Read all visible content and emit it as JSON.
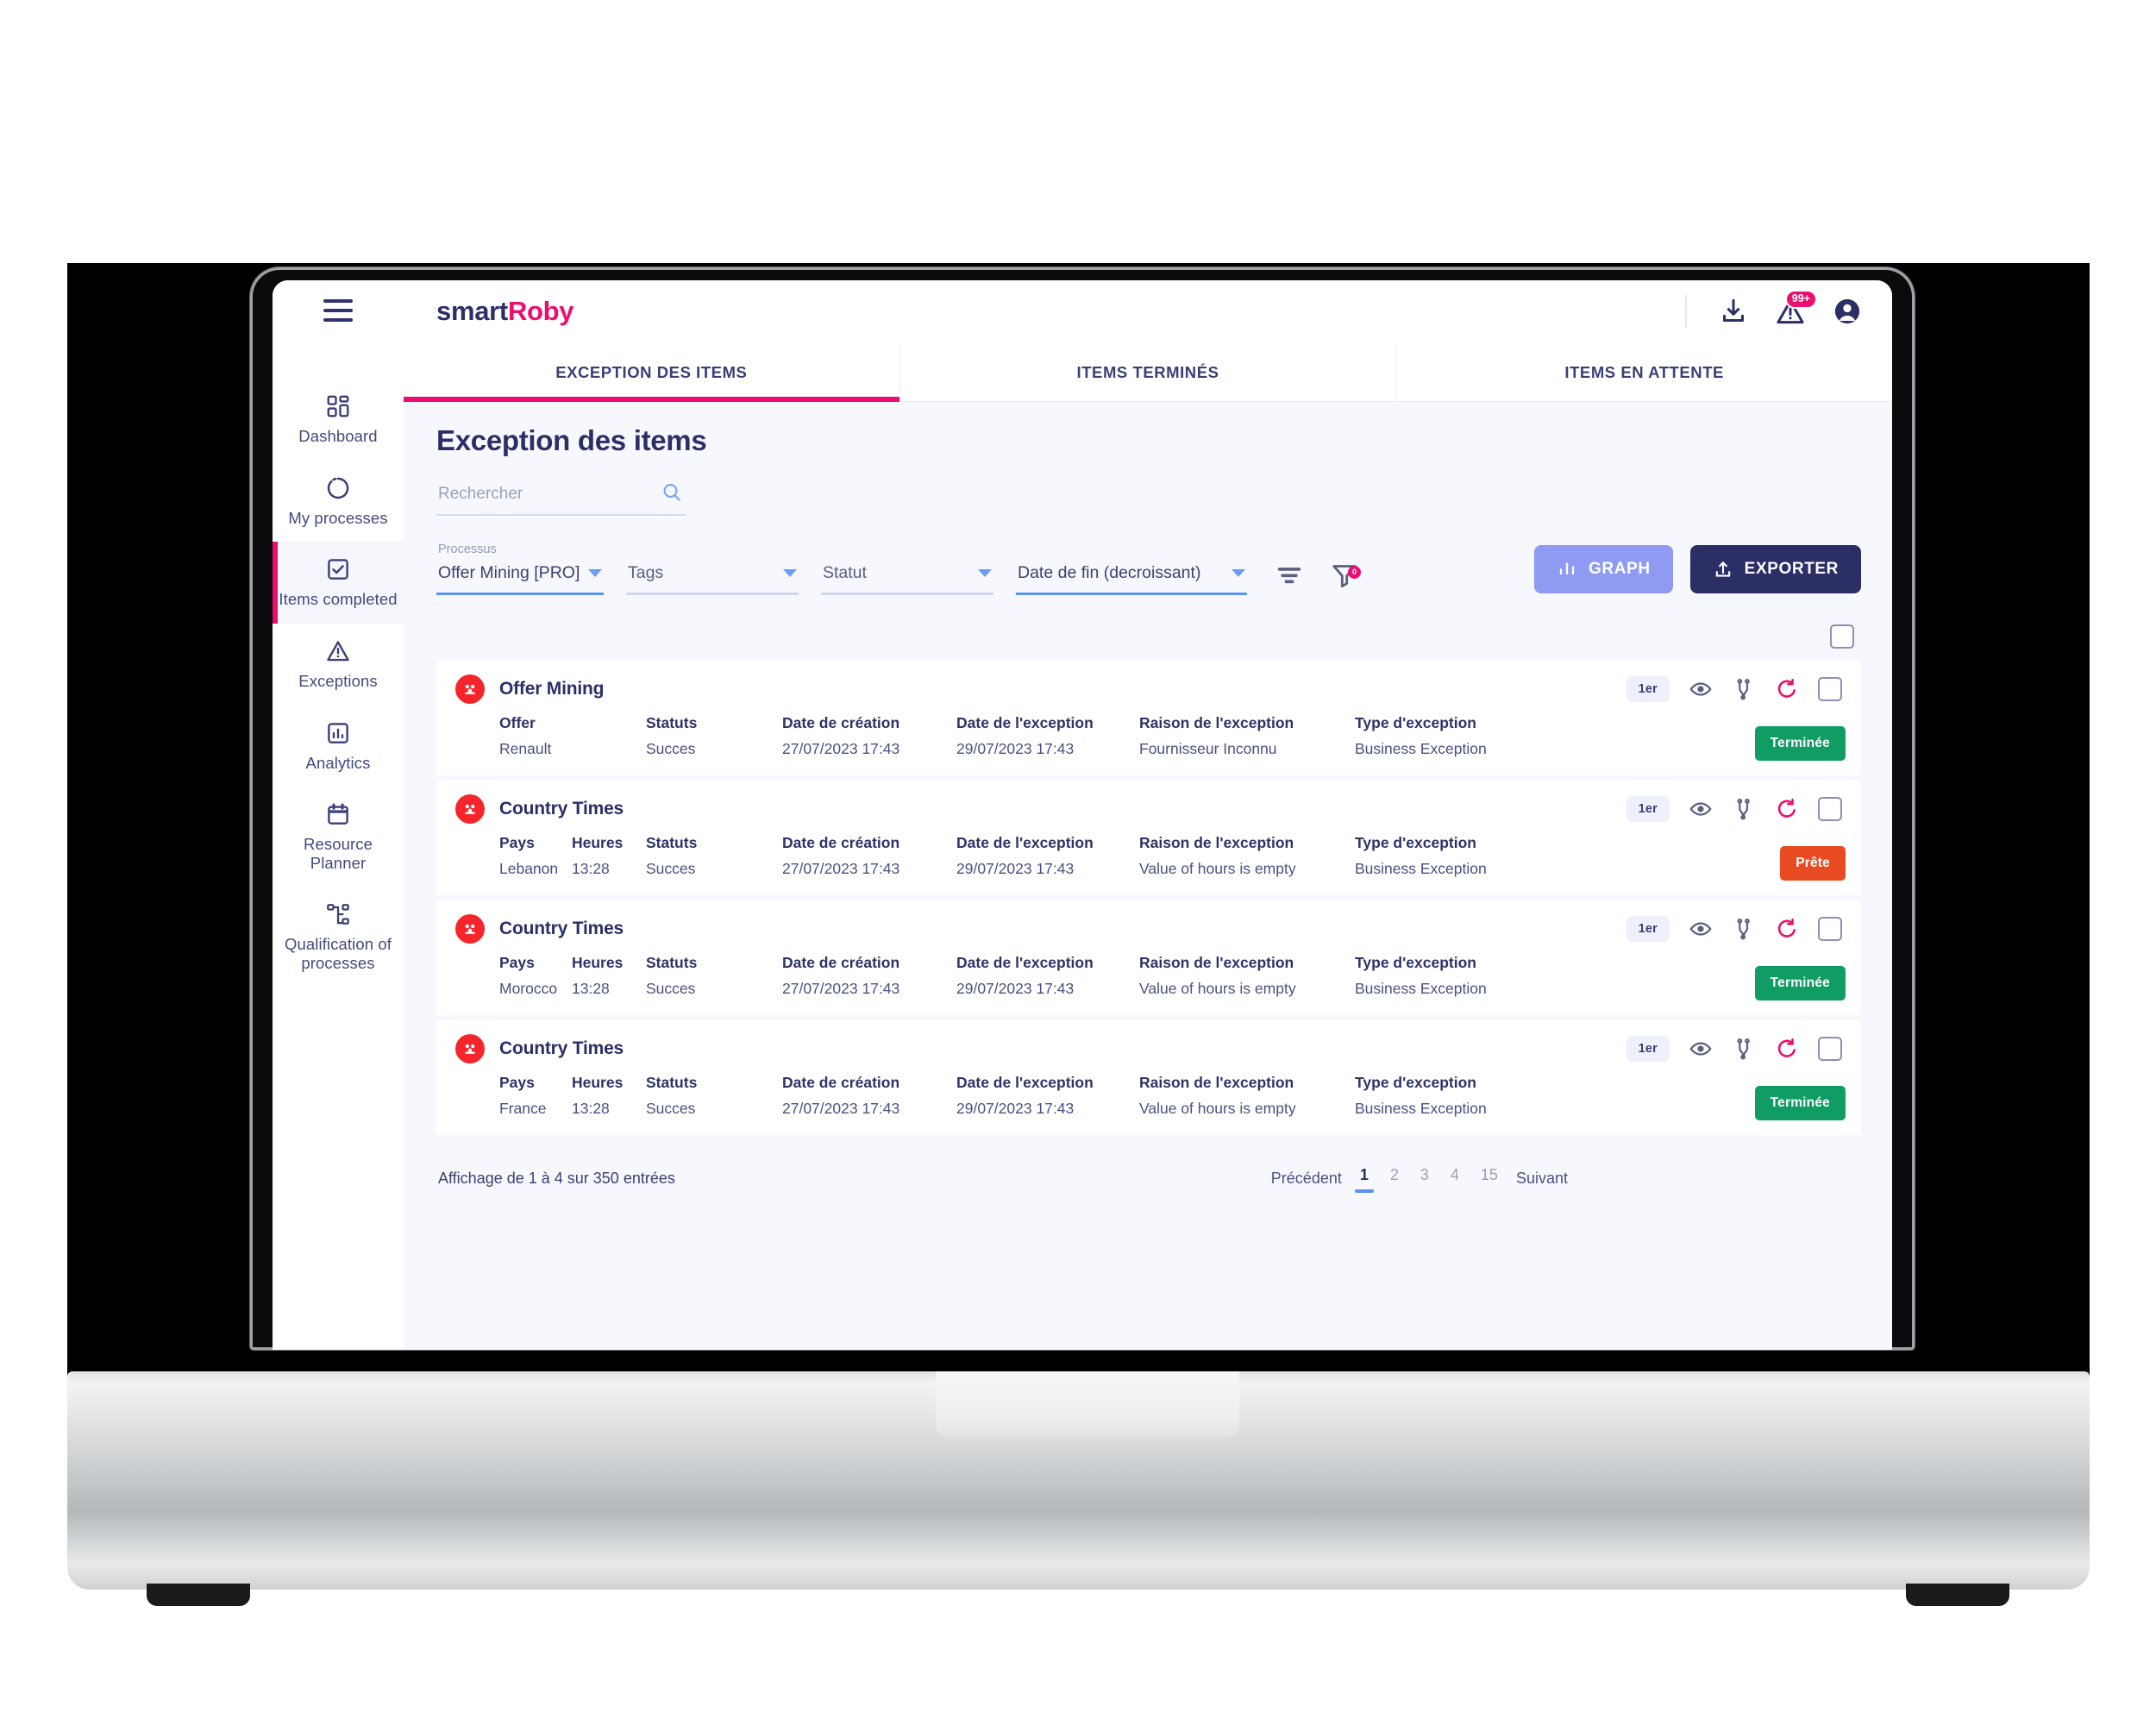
{
  "brand": {
    "part1": "smart",
    "part2": "Roby"
  },
  "topbar": {
    "menu_icon": "hamburger-icon",
    "download_icon": "download-icon",
    "alerts_icon": "warning-triangle-icon",
    "alerts_badge": "99+",
    "account_icon": "user-avatar-icon"
  },
  "sidebar": {
    "items": [
      {
        "label": "Dashboard",
        "icon": "dashboard-grid-icon",
        "active": false
      },
      {
        "label": "My processes",
        "icon": "circle-dashed-icon",
        "active": false
      },
      {
        "label": "Items completed",
        "icon": "checkbox-check-icon",
        "active": true
      },
      {
        "label": "Exceptions",
        "icon": "warning-triangle-icon",
        "active": false
      },
      {
        "label": "Analytics",
        "icon": "bar-chart-icon",
        "active": false
      },
      {
        "label": "Resource Planner",
        "icon": "calendar-icon",
        "active": false
      },
      {
        "label": "Qualification of processes",
        "icon": "sitemap-icon",
        "active": false
      }
    ]
  },
  "tabs": [
    {
      "label": "EXCEPTION DES ITEMS",
      "active": true
    },
    {
      "label": "ITEMS TERMINÉS",
      "active": false
    },
    {
      "label": "ITEMS EN ATTENTE",
      "active": false
    }
  ],
  "page": {
    "title": "Exception des items"
  },
  "search": {
    "placeholder": "Rechercher",
    "value": "",
    "icon": "search-icon"
  },
  "filters": {
    "processus": {
      "caption": "Processus",
      "value": "Offer Mining [PRO]"
    },
    "tags": {
      "value": "Tags"
    },
    "statut": {
      "value": "Statut"
    },
    "tri": {
      "value": "Date de fin (decroissant)"
    },
    "sort_icon": "sort-lines-icon",
    "filter_icon": "funnel-icon",
    "filter_count": "0"
  },
  "toolbar": {
    "graph_label": "GRAPH",
    "graph_icon": "bar-chart-icon",
    "graph_color": "#8f9bf2",
    "export_label": "EXPORTER",
    "export_icon": "upload-icon",
    "export_color": "#2b2f66"
  },
  "table": {
    "select_all_checked": false,
    "row_tools": {
      "rank_badge": "1er",
      "view_icon": "eye-icon",
      "compare_icon": "compare-icon",
      "retry_icon": "retry-arrow-icon",
      "select_icon": "checkbox-icon"
    },
    "rows": [
      {
        "process": "Offer Mining",
        "icon": "process-red-icon",
        "rank": "1er",
        "status": {
          "label": "Terminée",
          "kind": "ok",
          "color": "#0f9d63"
        },
        "cells": [
          {
            "key": "offer",
            "header": "Offer",
            "value": "Renault"
          },
          {
            "key": "statuts",
            "header": "Statuts",
            "value": "Succes"
          },
          {
            "key": "datec",
            "header": "Date de création",
            "value": "27/07/2023 17:43"
          },
          {
            "key": "datee",
            "header": "Date de l'exception",
            "value": "29/07/2023 17:43"
          },
          {
            "key": "raison",
            "header": "Raison de l'exception",
            "value": "Fournisseur Inconnu"
          },
          {
            "key": "type",
            "header": "Type d'exception",
            "value": "Business Exception"
          }
        ]
      },
      {
        "process": "Country Times",
        "icon": "process-red-icon",
        "rank": "1er",
        "status": {
          "label": "Prête",
          "kind": "warn",
          "color": "#e84b22"
        },
        "cells": [
          {
            "key": "pays",
            "header": "Pays",
            "value": "Lebanon"
          },
          {
            "key": "heures",
            "header": "Heures",
            "value": "13:28"
          },
          {
            "key": "statuts",
            "header": "Statuts",
            "value": "Succes"
          },
          {
            "key": "datec",
            "header": "Date de création",
            "value": "27/07/2023 17:43"
          },
          {
            "key": "datee",
            "header": "Date de l'exception",
            "value": "29/07/2023 17:43"
          },
          {
            "key": "raison",
            "header": "Raison de l'exception",
            "value": "Value of hours is empty"
          },
          {
            "key": "type",
            "header": "Type d'exception",
            "value": "Business Exception"
          }
        ]
      },
      {
        "process": "Country Times",
        "icon": "process-red-icon",
        "rank": "1er",
        "status": {
          "label": "Terminée",
          "kind": "ok",
          "color": "#0f9d63"
        },
        "cells": [
          {
            "key": "pays",
            "header": "Pays",
            "value": "Morocco"
          },
          {
            "key": "heures",
            "header": "Heures",
            "value": "13:28"
          },
          {
            "key": "statuts",
            "header": "Statuts",
            "value": "Succes"
          },
          {
            "key": "datec",
            "header": "Date de création",
            "value": "27/07/2023 17:43"
          },
          {
            "key": "datee",
            "header": "Date de l'exception",
            "value": "29/07/2023 17:43"
          },
          {
            "key": "raison",
            "header": "Raison de l'exception",
            "value": "Value of hours is empty"
          },
          {
            "key": "type",
            "header": "Type d'exception",
            "value": "Business Exception"
          }
        ]
      },
      {
        "process": "Country Times",
        "icon": "process-red-icon",
        "rank": "1er",
        "status": {
          "label": "Terminée",
          "kind": "ok",
          "color": "#0f9d63"
        },
        "cells": [
          {
            "key": "pays",
            "header": "Pays",
            "value": "France"
          },
          {
            "key": "heures",
            "header": "Heures",
            "value": "13:28"
          },
          {
            "key": "statuts",
            "header": "Statuts",
            "value": "Succes"
          },
          {
            "key": "datec",
            "header": "Date de création",
            "value": "27/07/2023 17:43"
          },
          {
            "key": "datee",
            "header": "Date de l'exception",
            "value": "29/07/2023 17:43"
          },
          {
            "key": "raison",
            "header": "Raison de l'exception",
            "value": "Value of hours is empty"
          },
          {
            "key": "type",
            "header": "Type d'exception",
            "value": "Business Exception"
          }
        ]
      }
    ]
  },
  "pagination": {
    "info": "Affichage de 1 à 4 sur 350 entrées",
    "prev": "Précédent",
    "next": "Suivant",
    "pages": [
      "1",
      "2",
      "3",
      "4",
      "15"
    ],
    "current": "1"
  }
}
